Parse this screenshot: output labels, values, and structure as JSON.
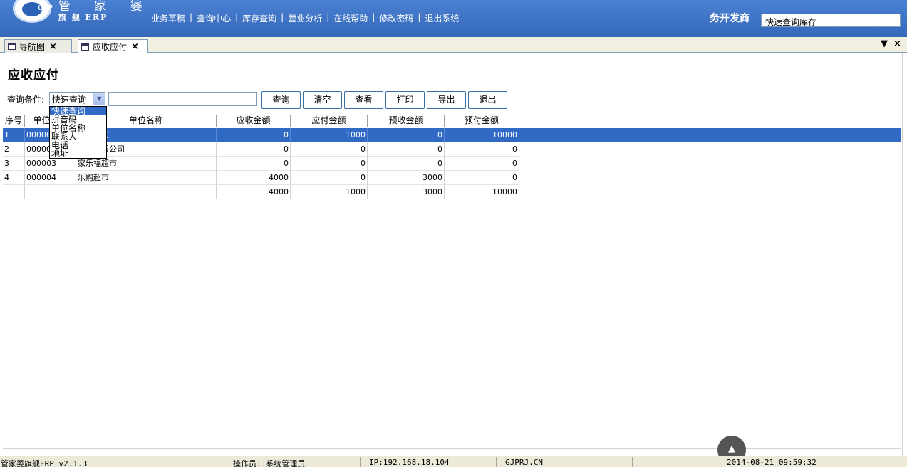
{
  "header": {
    "logo_text": "GJP",
    "brand_top": "管 家 婆",
    "brand_sub": "旗 舰 ERP",
    "nav": [
      "业务草稿",
      "查询中心",
      "库存查询",
      "营业分析",
      "在线帮助",
      "修改密码",
      "退出系统"
    ],
    "company": "务开发商",
    "quick_search_value": "快速查询库存"
  },
  "tabs": [
    {
      "label": "导航图"
    },
    {
      "label": "应收应付"
    }
  ],
  "page": {
    "title": "应收应付",
    "condition_label": "查询条件:",
    "condition_selected": "快速查询",
    "condition_options": [
      "快速查询",
      "拼音码",
      "单位名称",
      "联系人",
      "电话",
      "地址"
    ],
    "condition_value": "",
    "buttons": {
      "query": "查询",
      "clear": "清空",
      "view": "查看",
      "print": "打印",
      "export": "导出",
      "exit": "退出"
    }
  },
  "grid": {
    "headers": [
      "序号",
      "单位编号",
      "单位名称",
      "应收金额",
      "应付金额",
      "预收金额",
      "预付金额"
    ],
    "rows": [
      {
        "no": "1",
        "code": "000001",
        "name": "贸易公司",
        "receivable": "0",
        "payable": "1000",
        "adv_recv": "0",
        "adv_pay": "10000"
      },
      {
        "no": "2",
        "code": "000002",
        "name": "贸易有限公司",
        "receivable": "0",
        "payable": "0",
        "adv_recv": "0",
        "adv_pay": "0"
      },
      {
        "no": "3",
        "code": "000003",
        "name": "家乐福超市",
        "receivable": "0",
        "payable": "0",
        "adv_recv": "0",
        "adv_pay": "0"
      },
      {
        "no": "4",
        "code": "000004",
        "name": "乐购超市",
        "receivable": "4000",
        "payable": "0",
        "adv_recv": "3000",
        "adv_pay": "0"
      }
    ],
    "totals": {
      "receivable": "4000",
      "payable": "1000",
      "adv_recv": "3000",
      "adv_pay": "10000"
    }
  },
  "status": {
    "app": "管家婆旗舰ERP v2.1.3",
    "operator": "操作员: 系统管理员",
    "ip": "IP:192.168.18.104",
    "site": "GJPRJ.CN",
    "datetime": "2014-08-21 09:59:32"
  },
  "colors": {
    "header": "#3f74c7",
    "selection": "#316ac5",
    "highlight_box": "#e02020"
  },
  "icons": {
    "scroll_top": "up-arrow-icon"
  }
}
